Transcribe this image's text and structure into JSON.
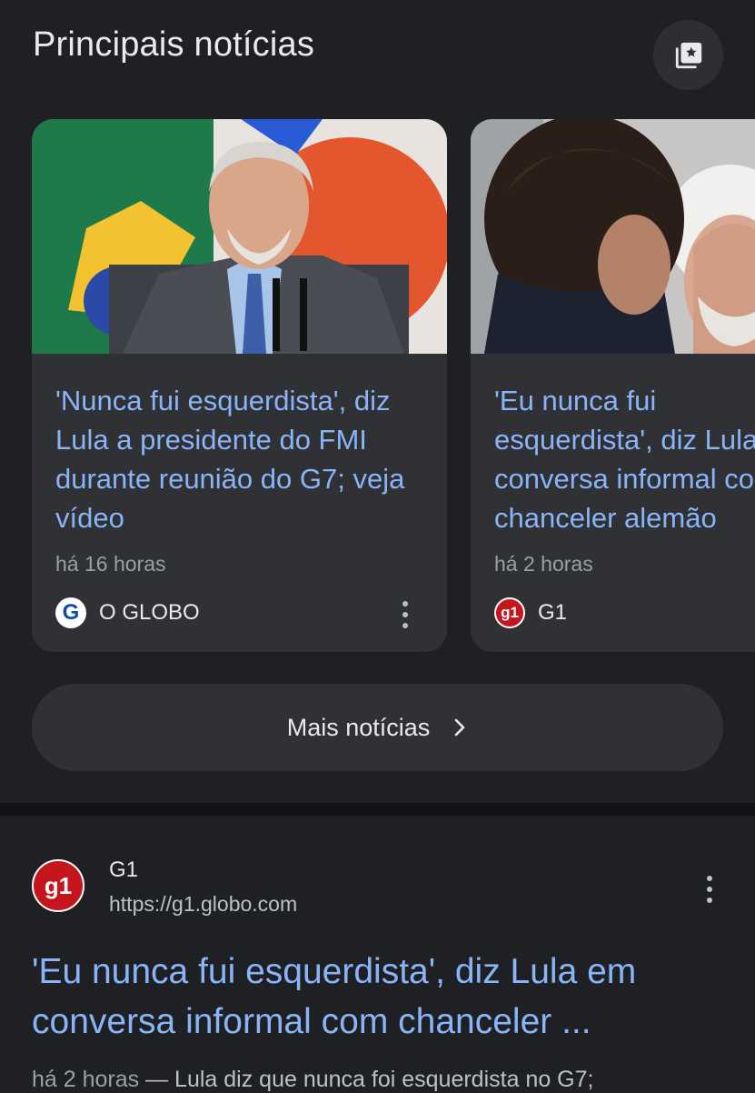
{
  "top_stories": {
    "title": "Principais notícias",
    "collections_icon": "collections-star-icon",
    "cards": [
      {
        "headline": "'Nunca fui esquerdista', diz Lula a presidente do FMI durante reunião do G7; veja vídeo",
        "time": "há 16 horas",
        "source": "O GLOBO",
        "source_logo_letter": "G",
        "source_logo_color": "#0b4ea2"
      },
      {
        "headline_lines": [
          "'Eu nunca fui",
          "esquerdista', diz Lula em",
          "conversa informal com",
          "chanceler alemão"
        ],
        "time": "há 2 horas",
        "source": "G1",
        "source_logo_text": "g1",
        "source_logo_color": "#c4161c"
      }
    ],
    "more_button": "Mais notícias"
  },
  "result": {
    "site": "G1",
    "url": "https://g1.globo.com",
    "logo_text": "g1",
    "title": "'Eu nunca fui esquerdista', diz Lula em conversa informal com chanceler ...",
    "snippet_time": "há 2 horas",
    "snippet_separator": " — ",
    "snippet_text": "Lula diz que nunca foi esquerdista no G7;"
  },
  "colors": {
    "background": "#1f2023",
    "card": "#303134",
    "link": "#8ab4f8",
    "text": "#e8eaed",
    "muted": "#9aa0a6"
  }
}
